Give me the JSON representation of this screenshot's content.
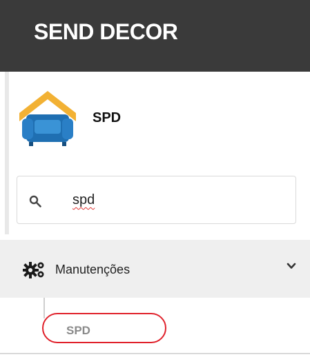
{
  "header": {
    "brand": "SEND DECOR"
  },
  "profile": {
    "name": "SPD",
    "logo_icon": "sofa-house-logo"
  },
  "search": {
    "value": "spd",
    "icon": "search-icon"
  },
  "menu": {
    "items": [
      {
        "label": "Manutenções",
        "icon": "gears-icon",
        "expanded": true,
        "children": [
          {
            "label": "SPD"
          }
        ]
      }
    ]
  },
  "colors": {
    "header_bg": "#3a3a3a",
    "menu_bg": "#efefef",
    "logo_roof": "#f2b134",
    "logo_sofa": "#1f6fb2",
    "highlight": "#e0202a"
  }
}
